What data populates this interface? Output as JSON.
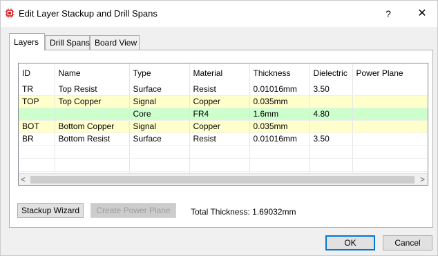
{
  "window": {
    "title": "Edit Layer Stackup and Drill Spans",
    "help_label": "?",
    "close_label": "✕"
  },
  "tabs": [
    {
      "label": "Layers",
      "active": true
    },
    {
      "label": "Drill Spans",
      "active": false
    },
    {
      "label": "Board View",
      "active": false
    }
  ],
  "layers_table": {
    "columns": [
      "ID",
      "Name",
      "Type",
      "Material",
      "Thickness",
      "Dielectric",
      "Power Plane"
    ],
    "rows": [
      {
        "cells": [
          "TR",
          "Top Resist",
          "Surface",
          "Resist",
          "0.01016mm",
          "3.50",
          ""
        ],
        "highlight": "#ffffff"
      },
      {
        "cells": [
          "TOP",
          "Top Copper",
          "Signal",
          "Copper",
          "0.035mm",
          "",
          ""
        ],
        "highlight": "#ffffcc"
      },
      {
        "cells": [
          "",
          "",
          "Core",
          "FR4",
          "1.6mm",
          "4.80",
          ""
        ],
        "highlight": "#ccffcc"
      },
      {
        "cells": [
          "BOT",
          "Bottom Copper",
          "Signal",
          "Copper",
          "0.035mm",
          "",
          ""
        ],
        "highlight": "#ffffcc"
      },
      {
        "cells": [
          "BR",
          "Bottom Resist",
          "Surface",
          "Resist",
          "0.01016mm",
          "3.50",
          ""
        ],
        "highlight": "#ffffff"
      }
    ]
  },
  "scrollbar": {
    "left_arrow": "<",
    "right_arrow": ">"
  },
  "buttons": {
    "stackup_wizard": "Stackup Wizard",
    "create_power_plane": "Create Power Plane",
    "ok": "OK",
    "cancel": "Cancel"
  },
  "total_thickness": "Total Thickness: 1.69032mm",
  "colors": {
    "signal_row": "#ffffcc",
    "core_row": "#ccffcc",
    "accent": "#0078d7",
    "app_icon": "#d42020"
  },
  "icons": {
    "app": "chip-icon"
  }
}
